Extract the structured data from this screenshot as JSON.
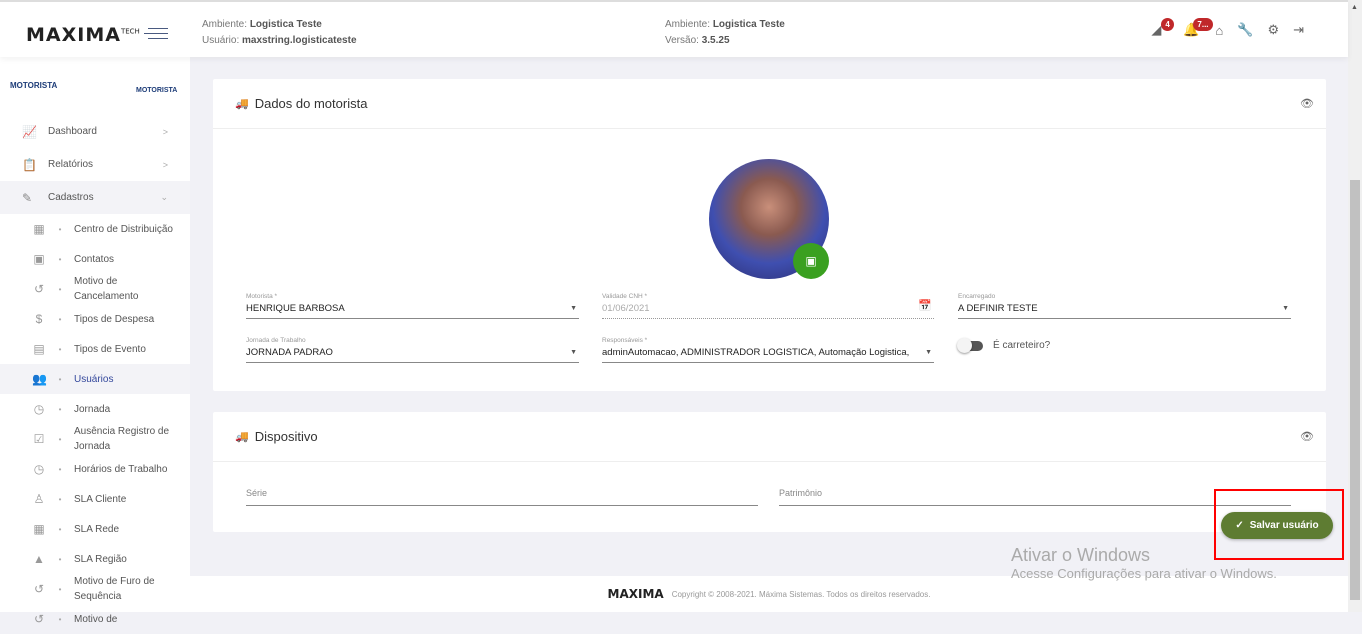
{
  "header": {
    "logo": "MAXIMA",
    "logo_sup": "TECH",
    "env1_label": "Ambiente:",
    "env1_value": "Logistica Teste",
    "user_label": "Usuário:",
    "user_value": "maxstring.logisticateste",
    "env2_label": "Ambiente:",
    "env2_value": "Logistica Teste",
    "version_label": "Versão:",
    "version_value": "3.5.25",
    "badge1": "4",
    "badge2": "7..."
  },
  "sidebar": {
    "logo_main": "MOTORISTA",
    "logo_small": "MOTORISTA",
    "nav": [
      {
        "label": "Dashboard"
      },
      {
        "label": "Relatórios"
      },
      {
        "label": "Cadastros"
      }
    ],
    "sub": [
      {
        "label": "Centro de Distribuição",
        "icon": "▦"
      },
      {
        "label": "Contatos",
        "icon": "▣"
      },
      {
        "label": "Motivo de Cancelamento",
        "icon": "↺"
      },
      {
        "label": "Tipos de Despesa",
        "icon": "$"
      },
      {
        "label": "Tipos de Evento",
        "icon": "▤"
      },
      {
        "label": "Usuários",
        "icon": "👥"
      },
      {
        "label": "Jornada",
        "icon": "◷"
      },
      {
        "label": "Ausência Registro de Jornada",
        "icon": "☑"
      },
      {
        "label": "Horários de Trabalho",
        "icon": "◷"
      },
      {
        "label": "SLA Cliente",
        "icon": "♙"
      },
      {
        "label": "SLA Rede",
        "icon": "▦"
      },
      {
        "label": "SLA Região",
        "icon": "▲"
      },
      {
        "label": "Motivo de Furo de Sequência",
        "icon": "↺"
      },
      {
        "label": "Motivo de",
        "icon": "↺"
      }
    ]
  },
  "driver": {
    "title": "Dados do motorista",
    "motorista_label": "Motorista *",
    "motorista": "HENRIQUE BARBOSA",
    "cnh_label": "Validade CNH *",
    "cnh": "01/06/2021",
    "encarregado_label": "Encarregado",
    "encarregado": "A DEFINIR TESTE",
    "jornada_label": "Jornada de Trabalho",
    "jornada": "JORNADA PADRAO",
    "resp_label": "Responsáveis *",
    "resp": "adminAutomacao, ADMINISTRADOR LOGISTICA, Automação Logistica, ...",
    "carreteiro_label": "É carreteiro?"
  },
  "device": {
    "title": "Dispositivo",
    "serie_label": "Série",
    "patrimonio_label": "Patrimônio"
  },
  "save_label": "Salvar usuário",
  "footer": {
    "logo": "MAXIMA",
    "copyright": "Copyright © 2008-2021. Máxima Sistemas. Todos os direitos reservados."
  },
  "watermark": {
    "title": "Ativar o Windows",
    "subtitle": "Acesse Configurações para ativar o Windows."
  }
}
